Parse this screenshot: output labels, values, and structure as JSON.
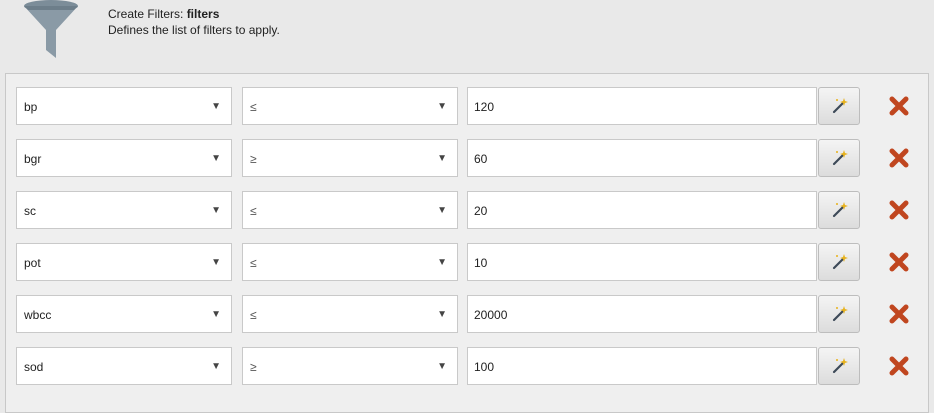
{
  "header": {
    "title_prefix": "Create Filters: ",
    "title_name": "filters",
    "description": "Defines the list of filters to apply."
  },
  "filters": [
    {
      "field": "bp",
      "operator": "≤",
      "value": "120"
    },
    {
      "field": "bgr",
      "operator": "≥",
      "value": "60"
    },
    {
      "field": "sc",
      "operator": "≤",
      "value": "20"
    },
    {
      "field": "pot",
      "operator": "≤",
      "value": "10"
    },
    {
      "field": "wbcc",
      "operator": "≤",
      "value": "20000"
    },
    {
      "field": "sod",
      "operator": "≥",
      "value": "100"
    }
  ],
  "icons": {
    "header": "funnel-icon",
    "dropdown": "chevron-down-icon",
    "wand": "magic-wand-icon",
    "remove": "close-icon"
  },
  "colors": {
    "funnel": "#8a9aa6",
    "remove": "#c0461f",
    "wand": "#3d4a58",
    "sparkle": "#e8b21c"
  }
}
